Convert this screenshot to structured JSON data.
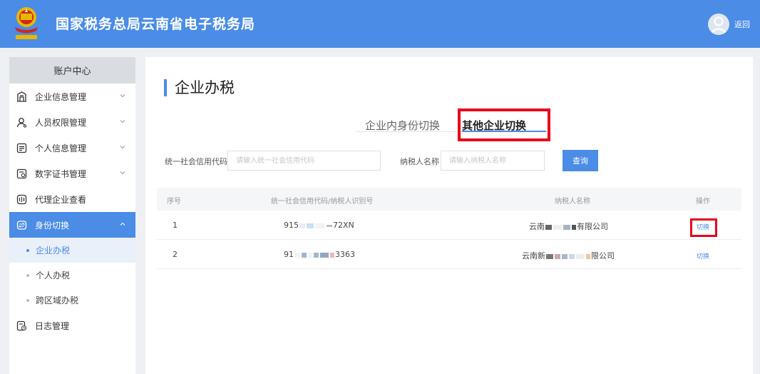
{
  "header": {
    "title": "国家税务总局云南省电子税务局",
    "back_label": "返回",
    "brand_color": "#4a8ce6"
  },
  "sidebar": {
    "heading": "账户中心",
    "items": [
      {
        "label": "企业信息管理",
        "icon": "building-icon"
      },
      {
        "label": "人员权限管理",
        "icon": "user-permission-icon"
      },
      {
        "label": "个人信息管理",
        "icon": "id-card-icon"
      },
      {
        "label": "数字证书管理",
        "icon": "certificate-icon"
      },
      {
        "label": "代理企业查看",
        "icon": "agent-icon"
      },
      {
        "label": "身份切换",
        "icon": "switch-identity-icon"
      },
      {
        "label": "日志管理",
        "icon": "log-icon"
      }
    ],
    "subitems": [
      {
        "label": "企业办税"
      },
      {
        "label": "个人办税"
      },
      {
        "label": "跨区域办税"
      }
    ]
  },
  "main": {
    "page_title": "企业办税",
    "tabs": [
      {
        "label": "企业内身份切换"
      },
      {
        "label": "其他企业切换"
      }
    ],
    "search": {
      "credit_code_label": "统一社会信用代码",
      "credit_code_placeholder": "请输入统一社会信用代码",
      "name_label": "纳税人名称",
      "name_placeholder": "请输入纳税人名称",
      "query_label": "查询"
    },
    "table": {
      "columns": [
        "序号",
        "统一社会信用代码/纳税人识别号",
        "纳税人名称",
        "操作"
      ],
      "rows": [
        {
          "index": "1",
          "code_prefix": "915",
          "code_suffix": "72XN",
          "name_prefix": "云南",
          "name_suffix": "有限公司",
          "action": "切换"
        },
        {
          "index": "2",
          "code_prefix": "91",
          "code_suffix": "3363",
          "name_prefix": "云南新",
          "name_suffix": "限公司",
          "action": "切换"
        }
      ]
    }
  },
  "colors": {
    "accent": "#4a8ce6",
    "highlight": "#e8001c"
  }
}
